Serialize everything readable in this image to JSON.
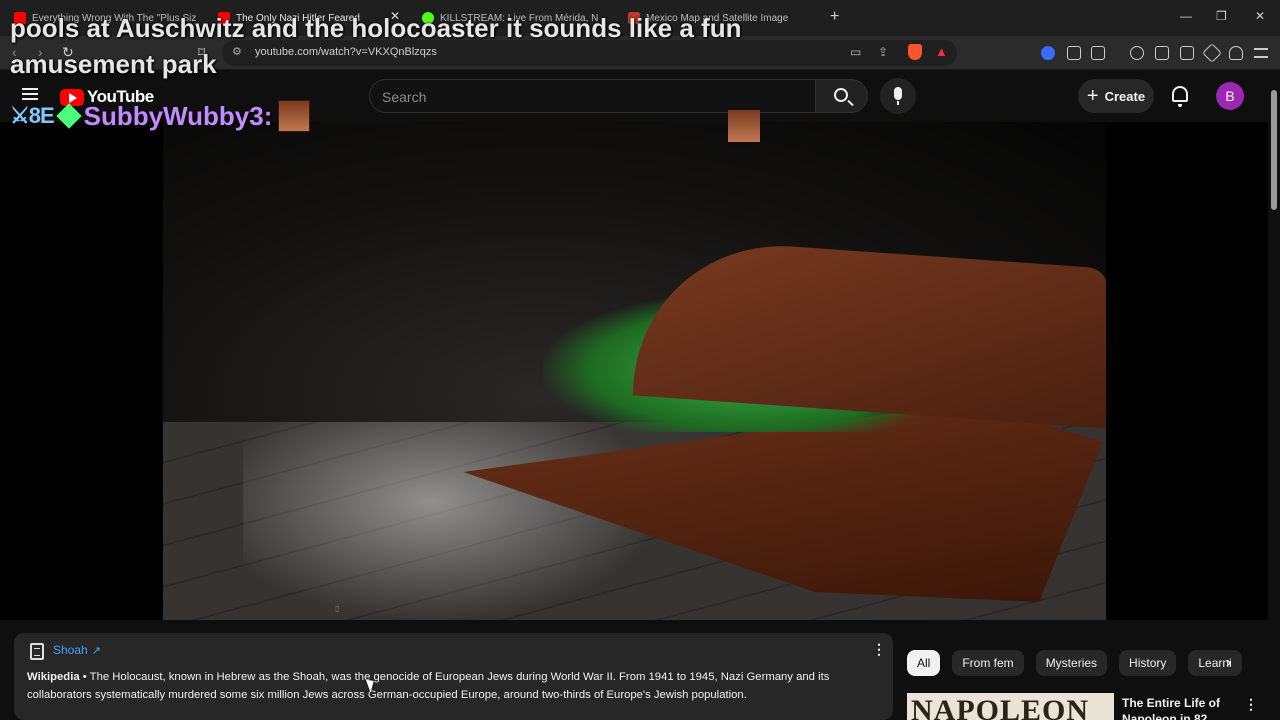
{
  "browser": {
    "tabs": [
      {
        "title": "Everything Wrong With The \"Plus Siz"
      },
      {
        "title": "The Only Nazi Hitler Feared"
      },
      {
        "title": "KILLSTREAM: Live From Mérida, N"
      },
      {
        "title": "Mexico Map and Satellite Image"
      }
    ],
    "url": "youtube.com/watch?v=VKXQnBlzqzs"
  },
  "overlay": {
    "line1": "pools at Auschwitz and the holocoaster it sounds like a fun",
    "line2": "amusement park",
    "badges": "⚔8E",
    "username": "SubbyWubby3:"
  },
  "header": {
    "logo_text": "YouTube",
    "search_placeholder": "Search",
    "create_label": "Create",
    "avatar_letter": "B"
  },
  "info_card": {
    "title": "Shoah",
    "source": "Wikipedia",
    "separator": " • ",
    "text": "The Holocaust, known in Hebrew as the Shoah, was the genocide of European Jews during World War II. From 1941 to 1945, Nazi Germany and its collaborators systematically murdered some six million Jews across German-occupied Europe, around two-thirds of Europe's Jewish population."
  },
  "chips": [
    "All",
    "From fem",
    "Mysteries",
    "History",
    "Learni"
  ],
  "related": {
    "thumb_text": "NAPOLEON",
    "title": "The Entire Life of Napoleon in 82"
  },
  "colors": {
    "accent_link": "#3ea6ff",
    "brand_red": "#ff0000",
    "avatar": "#9c27b0",
    "username": "#c48bff"
  }
}
